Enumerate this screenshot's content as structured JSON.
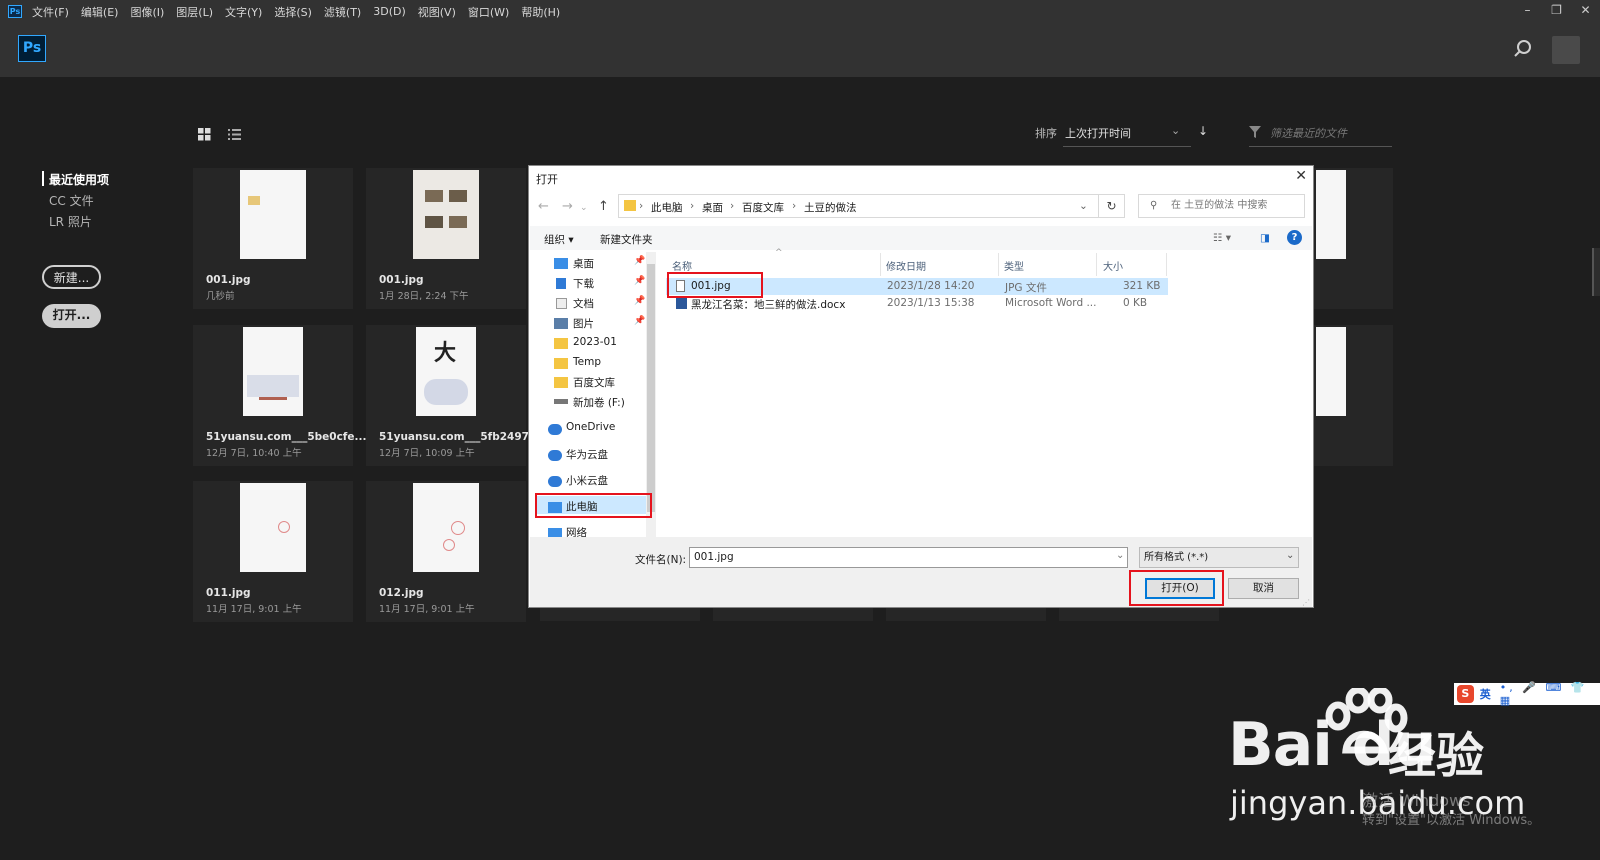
{
  "menubar": {
    "items": [
      "文件(F)",
      "编辑(E)",
      "图像(I)",
      "图层(L)",
      "文字(Y)",
      "选择(S)",
      "滤镜(T)",
      "3D(D)",
      "视图(V)",
      "窗口(W)",
      "帮助(H)"
    ]
  },
  "app": {
    "logo": "Ps"
  },
  "leftnav": {
    "items": [
      "最近使用项",
      "CC 文件",
      "LR 照片"
    ],
    "new_label": "新建...",
    "open_label": "打开..."
  },
  "sort": {
    "label": "排序",
    "value": "上次打开时间",
    "filter_placeholder": "筛选最近的文件"
  },
  "cards": [
    {
      "name": "001.jpg",
      "date": "几秒前"
    },
    {
      "name": "001.jpg",
      "date": "1月 28日, 2:24 下午"
    },
    {
      "name": "51yuansu.com___5be0cfe...",
      "date": "12月 7日, 10:40 上午"
    },
    {
      "name": "51yuansu.com___5fb2497...",
      "date": "12月 7日, 10:09 上午"
    },
    {
      "name": "011.jpg",
      "date": "11月 17日, 9:01 上午"
    },
    {
      "name": "012.jpg",
      "date": "11月 17日, 9:01 上午"
    }
  ],
  "dialog": {
    "title": "打开",
    "breadcrumb": [
      "此电脑",
      "桌面",
      "百度文库",
      "土豆的做法"
    ],
    "search_placeholder": "在 土豆的做法 中搜索",
    "toolbar": {
      "organize": "组织 ▾",
      "new_folder": "新建文件夹"
    },
    "sidebar": [
      {
        "label": "桌面",
        "pinned": true
      },
      {
        "label": "下载",
        "pinned": true
      },
      {
        "label": "文档",
        "pinned": true
      },
      {
        "label": "图片",
        "pinned": true
      },
      {
        "label": "2023-01"
      },
      {
        "label": "Temp"
      },
      {
        "label": "百度文库"
      },
      {
        "label": "新加卷 (F:)"
      },
      {
        "label": "OneDrive"
      },
      {
        "label": "华为云盘"
      },
      {
        "label": "小米云盘"
      },
      {
        "label": "此电脑"
      },
      {
        "label": "网络"
      }
    ],
    "columns": [
      "名称",
      "修改日期",
      "类型",
      "大小"
    ],
    "files": [
      {
        "name": "001.jpg",
        "date": "2023/1/28 14:20",
        "type": "JPG 文件",
        "size": "321 KB"
      },
      {
        "name": "黑龙江名菜：地三鲜的做法.docx",
        "date": "2023/1/13 15:38",
        "type": "Microsoft Word ...",
        "size": "0 KB"
      }
    ],
    "filename_label": "文件名(N):",
    "filename_value": "001.jpg",
    "filetype_value": "所有格式 (*.*)",
    "open_button": "打开(O)",
    "cancel_button": "取消"
  },
  "ime": {
    "lang": "英",
    "symbols": "•, 🎤 ⌨ 👕 ▦"
  },
  "watermark": {
    "brand": "Bai du",
    "cn": "经验",
    "url": "jingyan.baidu.com",
    "activate1": "激活 Windows",
    "activate2": "转到\"设置\"以激活 Windows。"
  },
  "colors": {
    "ps_blue": "#31a8ff",
    "highlight": "#e5131d",
    "select": "#cce8ff"
  }
}
